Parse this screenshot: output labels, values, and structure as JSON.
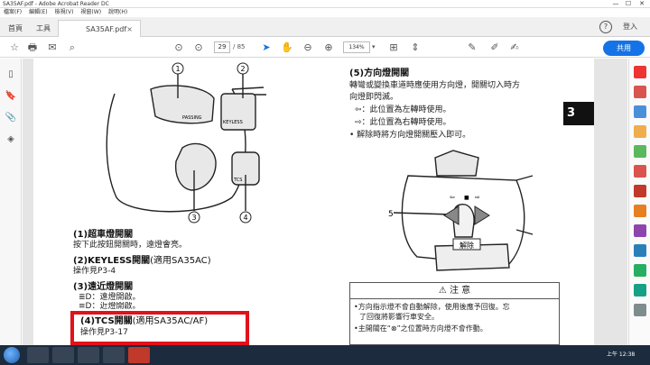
{
  "window": {
    "title": "SA35AF.pdf - Adobe Acrobat Reader DC",
    "min": "—",
    "max": "☐",
    "close": "✕"
  },
  "menu": [
    "檔案(F)",
    "編輯(E)",
    "檢視(V)",
    "視窗(W)",
    "說明(H)"
  ],
  "tabs": {
    "home": "首頁",
    "tools": "工具",
    "doc": "SA35AF.pdf",
    "close": "×"
  },
  "account": {
    "help": "?",
    "signin": "登入"
  },
  "toolbar": {
    "page_current": "29",
    "page_total": "/ 85",
    "zoom": "134%",
    "share": "共用"
  },
  "page": {
    "chapter": "3",
    "callouts": [
      "1",
      "2",
      "3",
      "4",
      "5"
    ],
    "switch_labels": {
      "passing": "PASSING",
      "keyless": "KEYLESS",
      "tcs": "TCS",
      "release": "解除"
    },
    "left": {
      "s1_title": "(1)超車燈開關",
      "s1_body": "按下此按鈕開關時，遠燈會亮。",
      "s2_title": "(2)KEYLESS開關",
      "s2_title_note": "(適用SA35AC)",
      "s2_body": "操作見P3-4",
      "s3_title": "(3)遠近燈開關",
      "s3_body1": "：遠燈開啟。",
      "s3_body2": "：近燈開啟。",
      "s4_title": "(4)TCS開關",
      "s4_title_note": "(適用SA35AC/AF)",
      "s4_body": "操作見P3-17"
    },
    "right": {
      "s5_title": "(5)方向燈開關",
      "s5_line1": "轉彎或變換車道時應使用方向燈，開關切入時方",
      "s5_line2": "向燈即閃滅。",
      "s5_left": "：此位置為左轉時使用。",
      "s5_right": "：此位置為右轉時使用。",
      "s5_release": "• 解除時將方向燈開關壓入即可。"
    },
    "warning": {
      "title": "注 意",
      "l1": "•方向指示燈不會自動解除，使用後應予回復。忘",
      "l2": "了回復將影響行車安全。",
      "l3": "•主開關在“",
      "l3b": "”之位置時方向燈不會作動。"
    }
  },
  "taskbar": {
    "time": "上午 12:38"
  }
}
